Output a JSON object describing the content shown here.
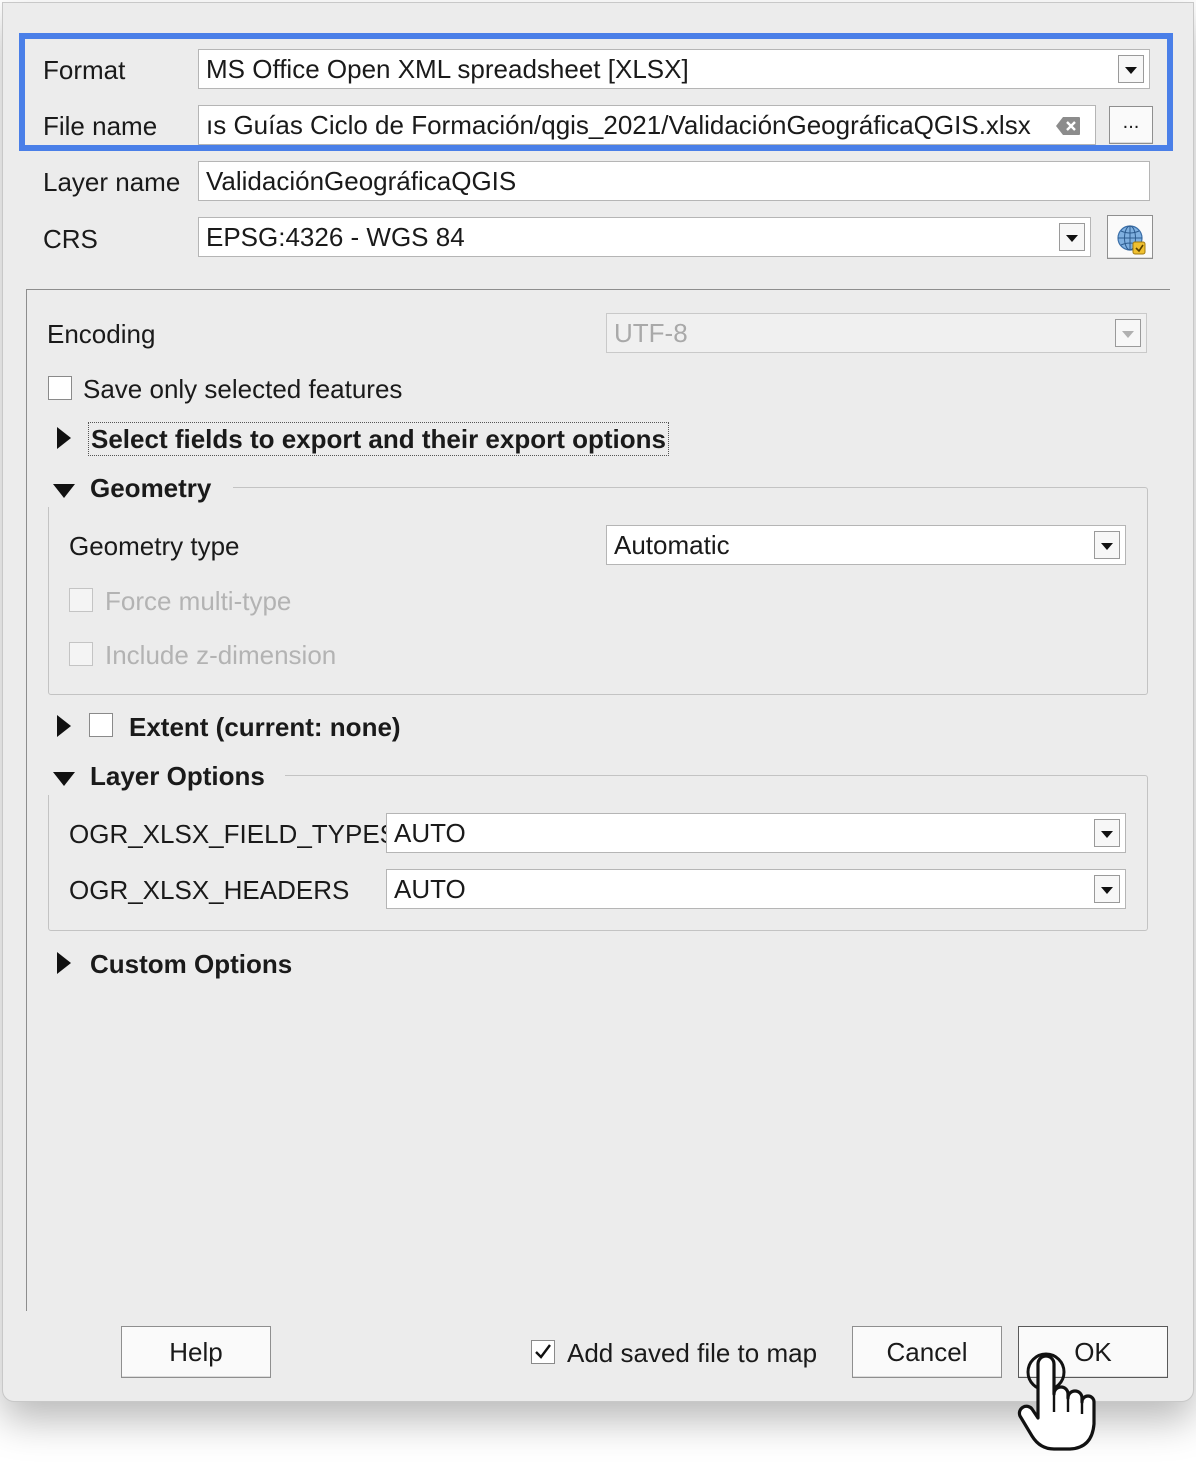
{
  "form": {
    "format_label": "Format",
    "format_value": "MS Office Open XML spreadsheet [XLSX]",
    "filename_label": "File name",
    "filename_value": "ıs Guías Ciclo de Formación/qgis_2021/ValidaciónGeográficaQGIS.xlsx",
    "browse_label": "...",
    "layername_label": "Layer name",
    "layername_value": "ValidaciónGeográficaQGIS",
    "crs_label": "CRS",
    "crs_value": "EPSG:4326 - WGS 84"
  },
  "options": {
    "encoding_label": "Encoding",
    "encoding_value": "UTF-8",
    "save_selected_label": "Save only selected features",
    "select_fields_label": "Select fields to export and their export options",
    "geometry": {
      "title": "Geometry",
      "type_label": "Geometry type",
      "type_value": "Automatic",
      "force_multi_label": "Force multi-type",
      "include_z_label": "Include z-dimension"
    },
    "extent_label": "Extent (current: none)",
    "layer_options": {
      "title": "Layer Options",
      "rows": [
        {
          "key": "OGR_XLSX_FIELD_TYPES",
          "value": "AUTO"
        },
        {
          "key": "OGR_XLSX_HEADERS",
          "value": "AUTO"
        }
      ]
    },
    "custom_options_label": "Custom Options"
  },
  "footer": {
    "help_label": "Help",
    "add_to_map_label": "Add saved file to map",
    "add_to_map_checked": true,
    "cancel_label": "Cancel",
    "ok_label": "OK"
  },
  "highlight_color": "#4a7fe8"
}
